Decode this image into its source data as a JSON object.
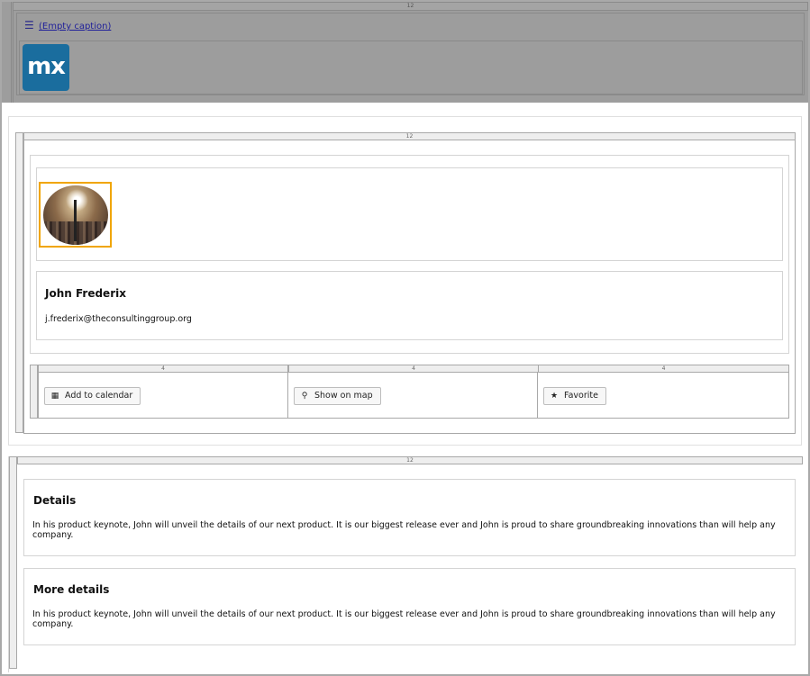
{
  "header": {
    "ruler_label": "12",
    "menu_icon": "hamburger-menu-icon",
    "caption": "(Empty caption)",
    "logo_text": "mx",
    "logo_color": "#1a6d9e"
  },
  "profile": {
    "ruler_label": "12",
    "avatar_icon": "speaker-microphone-photo",
    "avatar_border_color": "#f0a500",
    "name": "John Frederix",
    "email": "j.frederix@theconsultinggroup.org"
  },
  "actions": {
    "column_labels": [
      "4",
      "4",
      "4"
    ],
    "buttons": [
      {
        "label": "Add to calendar",
        "icon": "calendar-icon"
      },
      {
        "label": "Show on map",
        "icon": "map-marker-icon"
      },
      {
        "label": "Favorite",
        "icon": "star-icon"
      }
    ]
  },
  "details": {
    "ruler_label": "12",
    "sections": [
      {
        "title": "Details",
        "text": "In his product keynote, John will unveil the details of our next product. It is our biggest release ever and John is proud to share groundbreaking innovations than will help any company."
      },
      {
        "title": "More details",
        "text": "In his product keynote, John will unveil the details of our next product. It is our biggest release ever and John is proud to share groundbreaking innovations than will help any company."
      }
    ]
  }
}
